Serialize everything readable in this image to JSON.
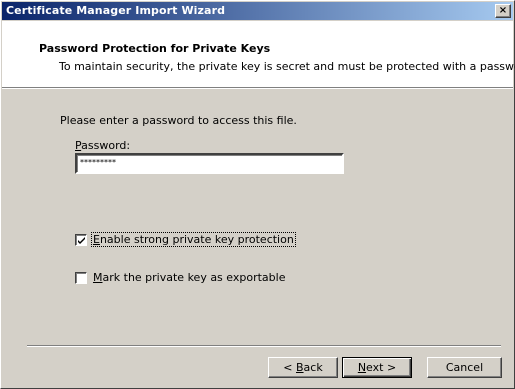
{
  "window": {
    "title": "Certificate Manager Import Wizard",
    "close_glyph": "×"
  },
  "header": {
    "title": "Password Protection for Private Keys",
    "subtitle": "To maintain security, the private key is secret and must be protected with a password."
  },
  "body": {
    "prompt": "Please enter a password to access this file.",
    "password_label_mnemonic": "P",
    "password_label_rest": "assword:",
    "password_value": "*********"
  },
  "options": {
    "strong_protection": {
      "mnemonic": "E",
      "rest": "nable strong private key protection",
      "checked": true
    },
    "exportable": {
      "mnemonic": "M",
      "rest": "ark the private key as exportable",
      "checked": false
    }
  },
  "buttons": {
    "back_prefix": "< ",
    "back_mnemonic": "B",
    "back_rest": "ack",
    "next_mnemonic": "N",
    "next_rest": "ext >",
    "cancel": "Cancel"
  },
  "colors": {
    "titlebar_start": "#0a246a",
    "titlebar_end": "#a6caf0",
    "face": "#d4d0c8"
  },
  "icons": {
    "close": "close-icon",
    "check": "checkmark-icon"
  }
}
